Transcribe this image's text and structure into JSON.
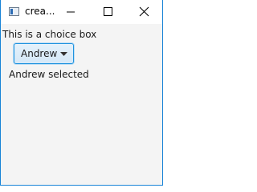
{
  "window": {
    "title": "crea..."
  },
  "icons": {
    "app": "app-window-icon",
    "minimize": "minimize-icon",
    "maximize": "maximize-icon",
    "close": "close-icon",
    "dropdown": "chevron-down-icon"
  },
  "colors": {
    "accent": "#1f93df",
    "window_border": "#1883d7",
    "content_bg": "#f4f4f4"
  },
  "content": {
    "label": "This is a choice box",
    "choice": {
      "selected": "Andrew"
    },
    "status": "Andrew selected"
  }
}
